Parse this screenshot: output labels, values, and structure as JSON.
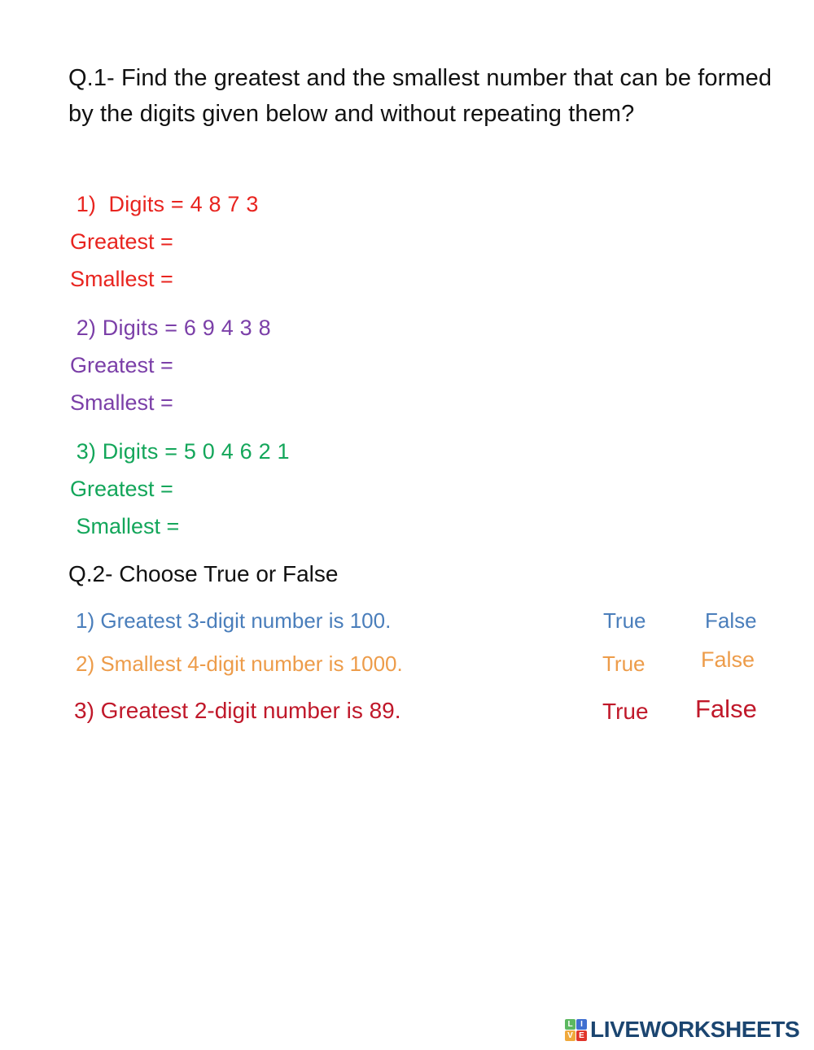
{
  "worksheet": {
    "q1": {
      "heading": "Q.1- Find the greatest and the smallest number that can be formed by the digits given below and without repeating them?",
      "groups": [
        {
          "number": "1)",
          "digits_line": " 1)  Digits = 4 8 7 3",
          "greatest_line": "Greatest =",
          "smallest_line": "Smallest =",
          "digits": "4 8 7 3",
          "color": "#e8241f"
        },
        {
          "number": "2)",
          "digits_line": " 2) Digits = 6 9 4 3 8",
          "greatest_line": "Greatest =",
          "smallest_line": "Smallest =",
          "digits": "6 9 4 3 8",
          "color": "#7b3fa8"
        },
        {
          "number": "3)",
          "digits_line": " 3) Digits = 5 0 4 6 2 1",
          "greatest_line": "Greatest =",
          "smallest_line": " Smallest =",
          "digits": "5 0 4 6 2 1",
          "color": "#13a65a"
        }
      ]
    },
    "q2": {
      "heading": "Q.2- Choose True or False",
      "rows": [
        {
          "statement": "1) Greatest 3-digit number is 100.",
          "true_label": "True",
          "false_label": "False",
          "color": "#4a7ebb"
        },
        {
          "statement": "2) Smallest 4-digit number is 1000.",
          "true_label": "True",
          "false_label": "False",
          "color": "#ed9c4a"
        },
        {
          "statement": "3) Greatest 2-digit number is 89.",
          "true_label": "True",
          "false_label": "False",
          "color": "#c0182a"
        }
      ]
    },
    "footer": {
      "brand": "LIVEWORKSHEETS",
      "brand_color": "#1b4570",
      "tiles": [
        {
          "letter": "L",
          "color": "#5cb860"
        },
        {
          "letter": "I",
          "color": "#3f6fd0"
        },
        {
          "letter": "V",
          "color": "#f0a93c"
        },
        {
          "letter": "E",
          "color": "#e0352b"
        }
      ]
    }
  }
}
